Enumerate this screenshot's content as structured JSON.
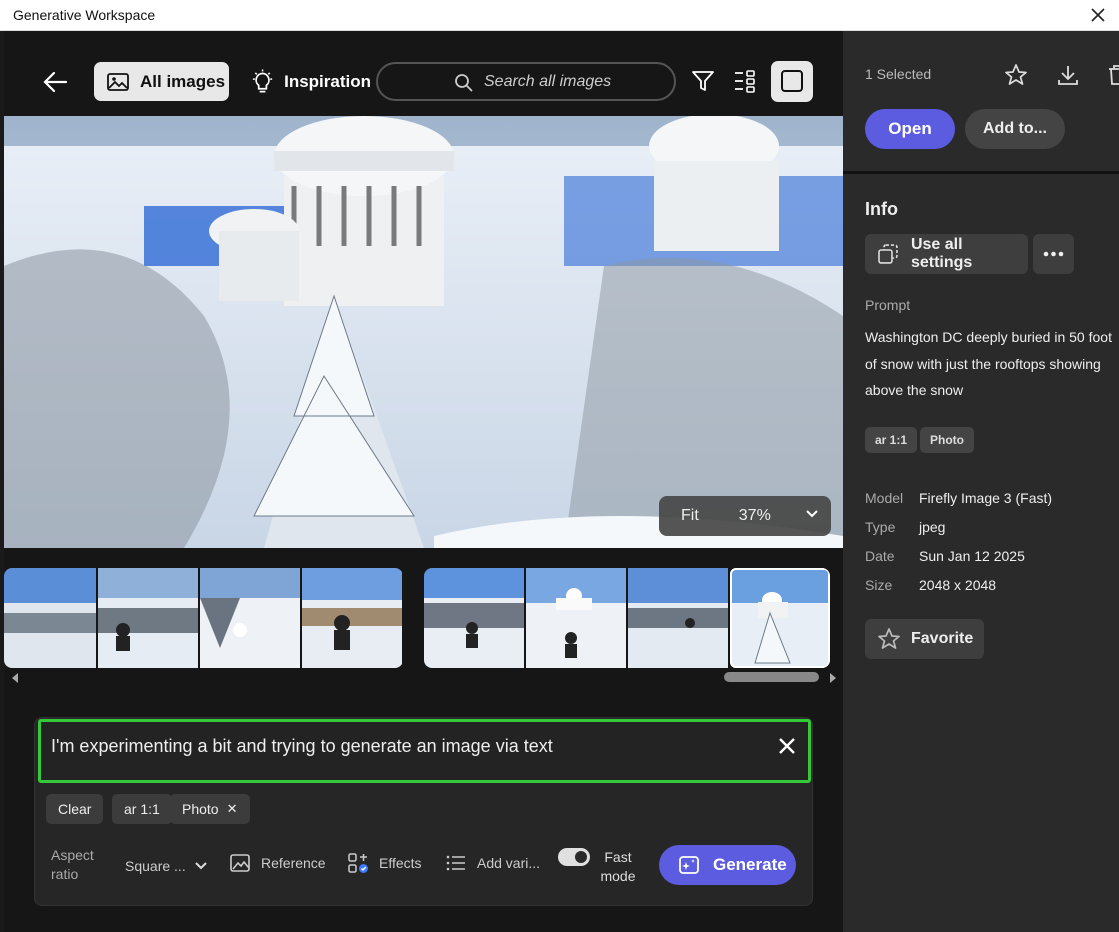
{
  "window": {
    "title": "Generative Workspace"
  },
  "toolbar": {
    "all_images_label": "All images",
    "inspiration_label": "Inspiration",
    "search_placeholder": "Search all images"
  },
  "viewer": {
    "fit_label": "Fit",
    "zoom_value": "37%"
  },
  "thumbnails": {
    "group1": [
      "snow-city-1",
      "snow-city-person-2",
      "snow-city-person-3",
      "snow-city-person-4"
    ],
    "group2": [
      "snow-person-5",
      "capitol-snow-6",
      "snow-person-7",
      "capitol-dome-snow-8"
    ]
  },
  "prompt_panel": {
    "prompt_text": "I'm experimenting a bit and trying to generate an image via text",
    "chips": {
      "clear": "Clear",
      "ar": "ar 1:1",
      "photo": "Photo"
    },
    "aspect_label_line1": "Aspect",
    "aspect_label_line2": "ratio",
    "aspect_value": "Square ...",
    "reference_label": "Reference",
    "effects_label": "Effects",
    "add_variation_label": "Add vari...",
    "fast_mode_line1": "Fast",
    "fast_mode_line2": "mode",
    "fast_mode_on": true,
    "generate_label": "Generate"
  },
  "sidebar": {
    "selected_count": "1 Selected",
    "open_label": "Open",
    "add_to_label": "Add to...",
    "info_heading": "Info",
    "use_all_settings_label": "Use all settings",
    "prompt_heading": "Prompt",
    "prompt_text": "Washington DC deeply buried in 50 foot of snow with just the rooftops showing above the snow",
    "tags": {
      "ar": "ar 1:1",
      "photo": "Photo"
    },
    "details": {
      "model_key": "Model",
      "model_value": "Firefly Image 3 (Fast)",
      "type_key": "Type",
      "type_value": "jpeg",
      "date_key": "Date",
      "date_value": "Sun Jan 12 2025",
      "size_key": "Size",
      "size_value": "2048 x 2048"
    },
    "favorite_label": "Favorite"
  },
  "colors": {
    "accent": "#5c5ce0",
    "prompt_focus_border": "#35c93a",
    "panel_bg": "#2a2a2a",
    "main_bg": "#161616"
  }
}
